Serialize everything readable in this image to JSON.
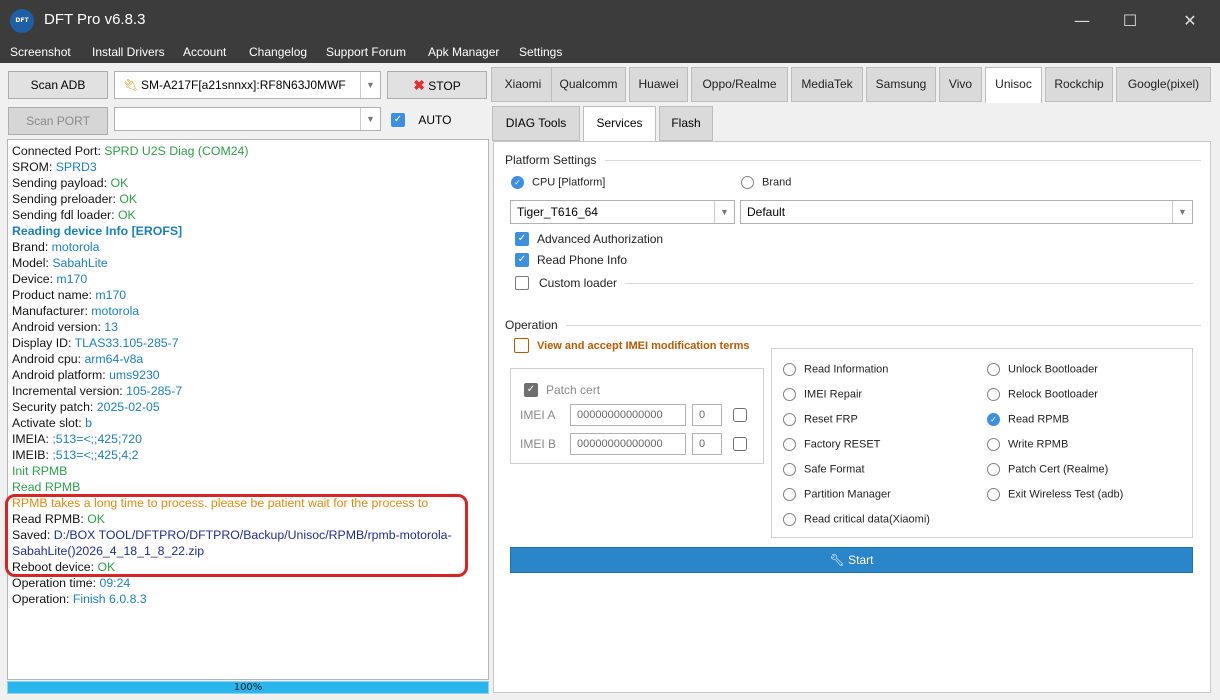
{
  "window": {
    "logo_text": "DFT",
    "title": "DFT Pro v6.8.3",
    "minimize": "—",
    "maximize": "☐",
    "close": "✕"
  },
  "menu": [
    "Screenshot",
    "Install Drivers",
    "Account",
    "Changelog",
    "Support Forum",
    "Apk Manager",
    "Settings"
  ],
  "left": {
    "scan_adb": "Scan ADB",
    "device_combo": "SM-A217F[a21snnxx]:RF8N63J0MWF",
    "stop": "STOP",
    "scan_port": "Scan PORT",
    "port_combo": "",
    "auto": "AUTO",
    "progress": "100%"
  },
  "log": [
    {
      "label": "Connected Port: ",
      "value": "SPRD U2S Diag (COM24)",
      "style": "green"
    },
    {
      "label": "SROM: ",
      "value": "SPRD3",
      "style": "blue"
    },
    {
      "label": "Sending payload: ",
      "value": "OK",
      "style": "green"
    },
    {
      "label": "Sending preloader: ",
      "value": "OK",
      "style": "green"
    },
    {
      "label": "Sending fdl loader: ",
      "value": "OK",
      "style": "green"
    },
    {
      "label": "",
      "value": "Reading device Info [EROFS]",
      "style": "head"
    },
    {
      "label": "Brand: ",
      "value": "motorola",
      "style": "blue"
    },
    {
      "label": "Model: ",
      "value": "SabahLite",
      "style": "blue"
    },
    {
      "label": "Device: ",
      "value": "m170",
      "style": "blue"
    },
    {
      "label": "Product name: ",
      "value": "m170",
      "style": "blue"
    },
    {
      "label": "Manufacturer: ",
      "value": "motorola",
      "style": "blue"
    },
    {
      "label": "Android version: ",
      "value": "13",
      "style": "blue"
    },
    {
      "label": "Display ID: ",
      "value": "TLAS33.105-285-7",
      "style": "blue"
    },
    {
      "label": "Android cpu: ",
      "value": "arm64-v8a",
      "style": "blue"
    },
    {
      "label": "Android platform: ",
      "value": "ums9230",
      "style": "blue"
    },
    {
      "label": "Incremental version: ",
      "value": "105-285-7",
      "style": "blue"
    },
    {
      "label": "Security patch: ",
      "value": "2025-02-05",
      "style": "blue"
    },
    {
      "label": "Activate slot: ",
      "value": "b",
      "style": "blue"
    },
    {
      "label": "IMEIA: ",
      "value": ";513=<;;425;720",
      "style": "blue"
    },
    {
      "label": "IMEIB: ",
      "value": ";513=<;;425;4;2",
      "style": "blue"
    },
    {
      "label": "",
      "value": "Init RPMB",
      "style": "green"
    },
    {
      "label": "",
      "value": "Read RPMB",
      "style": "green"
    },
    {
      "label": "",
      "value": "RPMB takes a long time to process. please be patient wait for the process to",
      "style": "orange"
    },
    {
      "label": "Read RPMB: ",
      "value": "OK",
      "style": "green"
    },
    {
      "label": "Saved: ",
      "value": "D:/BOX TOOL/DFTPRO/DFTPRO/Backup/Unisoc/RPMB/rpmb-motorola-",
      "style": "navy"
    },
    {
      "label": "",
      "value": "SabahLite()2026_4_18_1_8_22.zip",
      "style": "navy"
    },
    {
      "label": "Reboot device: ",
      "value": "OK",
      "style": "green"
    },
    {
      "label": "Operation time: ",
      "value": "09:24",
      "style": "blue"
    },
    {
      "label": "Operation: ",
      "value": "Finish 6.0.8.3",
      "style": "blue"
    }
  ],
  "tabs": [
    "Xiaomi",
    "Qualcomm",
    "Huawei",
    "Oppo/Realme",
    "MediaTek",
    "Samsung",
    "Vivo",
    "Unisoc",
    "Rockchip",
    "Google(pixel)"
  ],
  "subtabs": [
    "DIAG Tools",
    "Services",
    "Flash"
  ],
  "platform": {
    "heading": "Platform Settings",
    "cpu_label": "CPU [Platform]",
    "brand_label": "Brand",
    "cpu_value": "Tiger_T616_64",
    "brand_value": "Default",
    "advanced_auth": "Advanced Authorization",
    "read_phone_info": "Read Phone Info",
    "custom_loader": "Custom loader"
  },
  "operation": {
    "heading": "Operation",
    "terms": "View and accept IMEI modification terms",
    "patch_cert": "Patch cert",
    "imei_a": "IMEI A",
    "imei_b": "IMEI B",
    "imei_placeholder": "00000000000000",
    "imei_a_slot": "0",
    "imei_b_slot": "0",
    "col1": [
      "Read Information",
      "IMEI Repair",
      "Reset FRP",
      "Factory RESET",
      "Safe Format",
      "Partition Manager",
      "Read critical data(Xiaomi)"
    ],
    "col2": [
      "Unlock Bootloader",
      "Relock Bootloader",
      "Read RPMB",
      "Write RPMB",
      "Patch Cert (Realme)",
      "Exit Wireless Test (adb)"
    ],
    "start": "Start"
  },
  "colors": {
    "accent": "#3d8fe0",
    "start": "#2a85c9",
    "progress": "#28b6ec",
    "highlight": "#d82424",
    "terms": "#b85a00"
  },
  "icons": {
    "stop": "x-icon",
    "start": "wrench-icon",
    "device": "usb-icon"
  }
}
